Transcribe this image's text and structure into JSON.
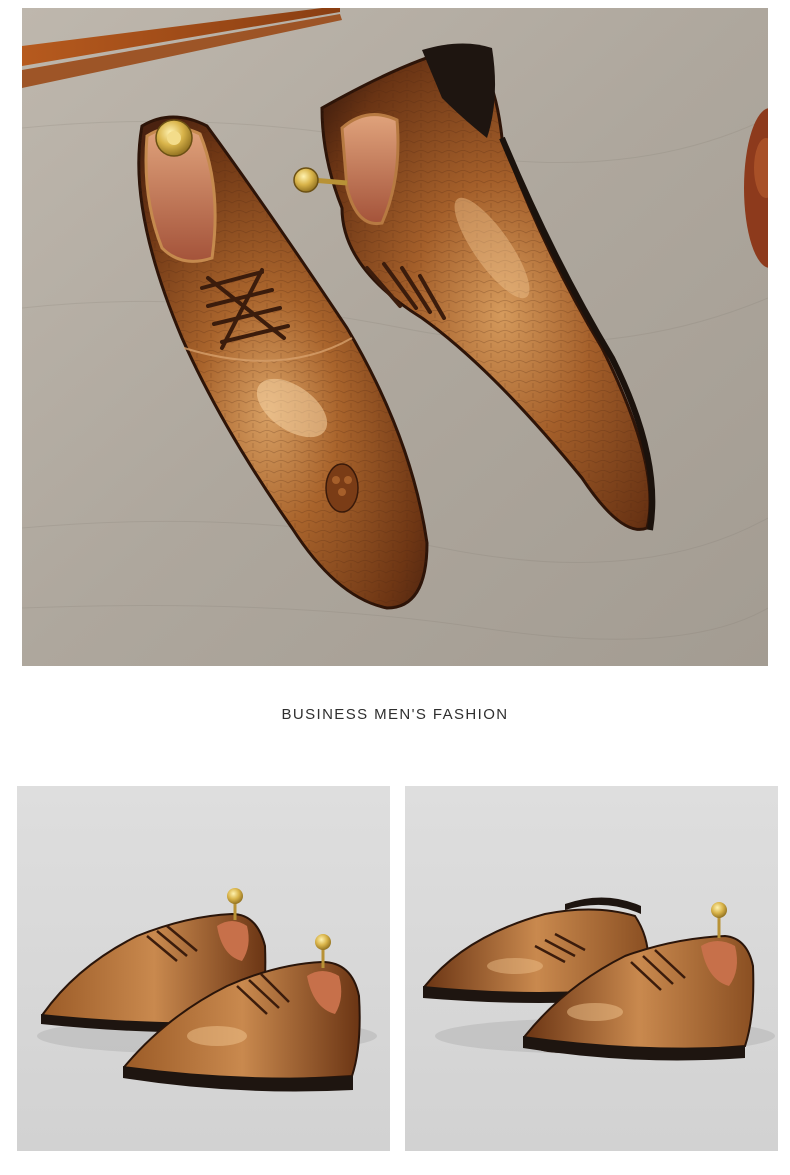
{
  "caption": "BUSINESS MEN'S FASHION",
  "images": {
    "hero": "shoes-top-view-photo",
    "left": "shoes-pair-side-view-photo",
    "right": "shoes-pair-angled-view-photo"
  },
  "colors": {
    "leather": "#8a4f22",
    "leather_light": "#c7874a",
    "leather_dark": "#4a2410",
    "backdrop": "#b3aca2",
    "studio": "#d8d8d8"
  }
}
